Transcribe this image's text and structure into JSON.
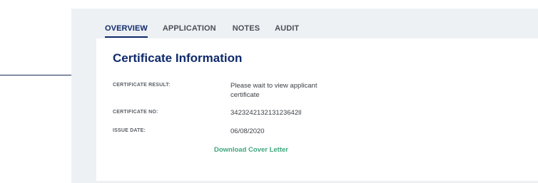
{
  "tabs": [
    {
      "label": "OVERVIEW",
      "active": true
    },
    {
      "label": "APPLICATION",
      "active": false
    },
    {
      "label": "NOTES",
      "active": false
    },
    {
      "label": "AUDIT",
      "active": false
    }
  ],
  "card": {
    "title": "Certificate Information",
    "rows": [
      {
        "label": "CERTIFICATE RESULT:",
        "value": "Please wait to view applicant certificate"
      },
      {
        "label": "CERTIFICATE NO:",
        "value": "342324213213123642ll"
      },
      {
        "label": "ISSUE DATE:",
        "value": "06/08/2020"
      }
    ],
    "download_link": "Download Cover Letter"
  },
  "colors": {
    "accent": "#0f2a6b",
    "link": "#3ea77d",
    "panel_bg": "#eef1f4"
  }
}
